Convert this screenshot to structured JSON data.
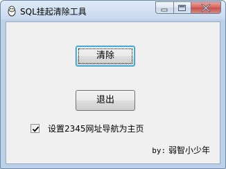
{
  "window": {
    "title": "SQL挂起清除工具",
    "icon": "qq-penguin-icon",
    "caption_buttons": [
      "minimize-icon",
      "maximize-icon",
      "close-icon"
    ]
  },
  "main": {
    "clear_button_label": "清除",
    "exit_button_label": "退出",
    "checkbox": {
      "label": "设置2345网址导航为主页",
      "checked": true
    },
    "credit_prefix": "by:",
    "credit_author": "弱智小少年"
  },
  "colors": {
    "titlebar": "#c9daee",
    "client_bg": "#f0f0f0",
    "close_button": "#c75050"
  }
}
